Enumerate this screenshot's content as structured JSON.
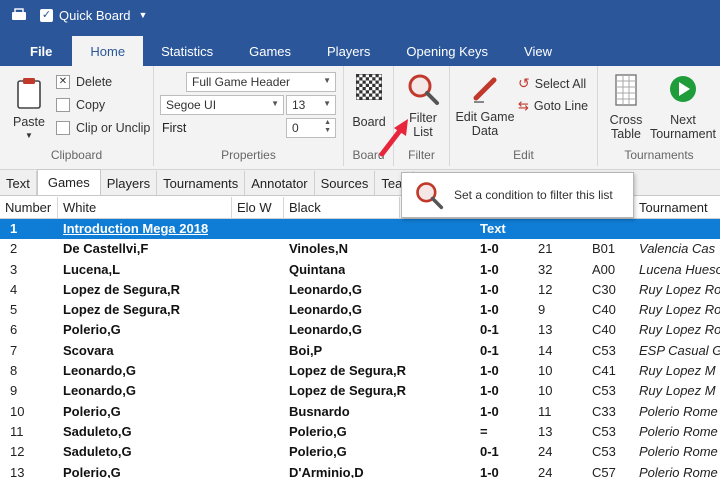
{
  "titlebar": {
    "app_label": "Quick Board",
    "colors": {
      "bg": "#2b579a"
    }
  },
  "tabs": [
    {
      "label": "File"
    },
    {
      "label": "Home"
    },
    {
      "label": "Statistics"
    },
    {
      "label": "Games"
    },
    {
      "label": "Players"
    },
    {
      "label": "Opening Keys"
    },
    {
      "label": "View"
    }
  ],
  "ribbon": {
    "clipboard": {
      "paste": "Paste",
      "delete": "Delete",
      "copy": "Copy",
      "clip": "Clip or Unclip",
      "label": "Clipboard"
    },
    "properties": {
      "header_select": "Full Game Header",
      "font_select": "Segoe UI",
      "size_select": "13",
      "first_label": "First",
      "first_value": "0",
      "label": "Properties"
    },
    "board": {
      "button": "Board",
      "label": "Board"
    },
    "filter": {
      "button_line1": "Filter",
      "button_line2": "List",
      "label": "Filter"
    },
    "edit": {
      "edit_line1": "Edit Game",
      "edit_line2": "Data",
      "select_all": "Select All",
      "goto_line": "Goto Line",
      "label": "Edit"
    },
    "tournaments": {
      "cross_line1": "Cross",
      "cross_line2": "Table",
      "next_line1": "Next",
      "next_line2": "Tournament",
      "label": "Tournaments"
    }
  },
  "tooltip": {
    "text": "Set a condition to filter this list"
  },
  "doctabs": [
    {
      "label": "Text"
    },
    {
      "label": "Games"
    },
    {
      "label": "Players"
    },
    {
      "label": "Tournaments"
    },
    {
      "label": "Annotator"
    },
    {
      "label": "Sources"
    },
    {
      "label": "Tear"
    }
  ],
  "table": {
    "headers": [
      "Number",
      "White",
      "Elo W",
      "Black",
      "Tournament"
    ],
    "rows": [
      {
        "num": "1",
        "white": "Introduction Mega 2018",
        "black": "",
        "result": "Text",
        "moves": "",
        "eco": "",
        "tournament": ""
      },
      {
        "num": "2",
        "white": "De Castellvi,F",
        "black": "Vinoles,N",
        "result": "1-0",
        "moves": "21",
        "eco": "B01",
        "tournament": "Valencia Cas"
      },
      {
        "num": "3",
        "white": "Lucena,L",
        "black": "Quintana",
        "result": "1-0",
        "moves": "32",
        "eco": "A00",
        "tournament": "Lucena Hueso"
      },
      {
        "num": "4",
        "white": "Lopez de Segura,R",
        "black": "Leonardo,G",
        "result": "1-0",
        "moves": "12",
        "eco": "C30",
        "tournament": "Ruy Lopez Ro"
      },
      {
        "num": "5",
        "white": "Lopez de Segura,R",
        "black": "Leonardo,G",
        "result": "1-0",
        "moves": "9",
        "eco": "C40",
        "tournament": "Ruy Lopez Ro"
      },
      {
        "num": "6",
        "white": "Polerio,G",
        "black": "Leonardo,G",
        "result": "0-1",
        "moves": "13",
        "eco": "C40",
        "tournament": "Ruy Lopez Ro"
      },
      {
        "num": "7",
        "white": "Scovara",
        "black": "Boi,P",
        "result": "0-1",
        "moves": "14",
        "eco": "C53",
        "tournament": "ESP Casual G"
      },
      {
        "num": "8",
        "white": "Leonardo,G",
        "black": "Lopez de Segura,R",
        "result": "1-0",
        "moves": "10",
        "eco": "C41",
        "tournament": "Ruy Lopez M"
      },
      {
        "num": "9",
        "white": "Leonardo,G",
        "black": "Lopez de Segura,R",
        "result": "1-0",
        "moves": "10",
        "eco": "C53",
        "tournament": "Ruy Lopez M"
      },
      {
        "num": "10",
        "white": "Polerio,G",
        "black": "Busnardo",
        "result": "1-0",
        "moves": "11",
        "eco": "C33",
        "tournament": "Polerio Rome"
      },
      {
        "num": "11",
        "white": "Saduleto,G",
        "black": "Polerio,G",
        "result": "=",
        "moves": "13",
        "eco": "C53",
        "tournament": "Polerio Rome"
      },
      {
        "num": "12",
        "white": "Saduleto,G",
        "black": "Polerio,G",
        "result": "0-1",
        "moves": "24",
        "eco": "C53",
        "tournament": "Polerio Rome"
      },
      {
        "num": "13",
        "white": "Polerio,G",
        "black": "D'Arminio,D",
        "result": "1-0",
        "moves": "24",
        "eco": "C57",
        "tournament": "Polerio Rome"
      }
    ]
  }
}
